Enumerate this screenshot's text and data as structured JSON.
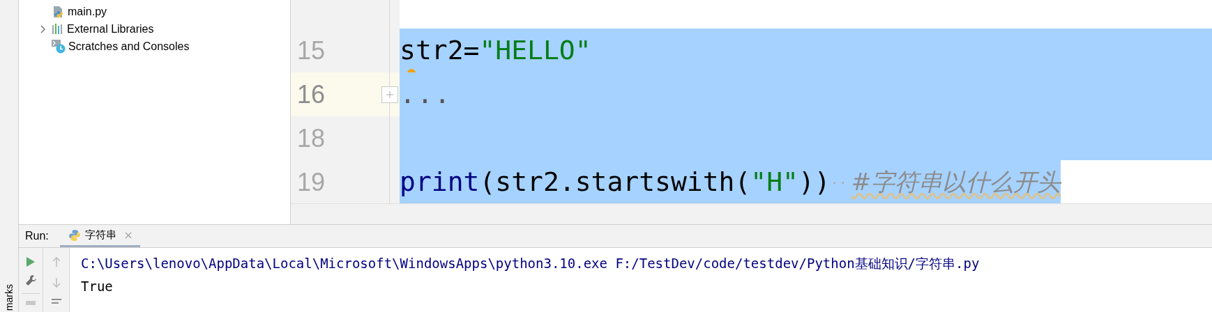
{
  "side_strip": {
    "label": "marks"
  },
  "project_tree": {
    "items": [
      {
        "label": "main.py",
        "kind": "python_file"
      },
      {
        "label": "External Libraries",
        "kind": "libraries",
        "expanded": false
      },
      {
        "label": "Scratches and Consoles",
        "kind": "scratches"
      }
    ]
  },
  "editor": {
    "lines": [
      {
        "number": "15",
        "selected": true,
        "current": false,
        "folded": false,
        "hint": true,
        "tokens": [
          {
            "kind": "plain",
            "text": "str2="
          },
          {
            "kind": "string",
            "text": "\"HELLO\""
          }
        ]
      },
      {
        "number": "16",
        "selected": true,
        "current": true,
        "folded": true,
        "hint": false,
        "tokens": [
          {
            "kind": "fold",
            "text": "..."
          }
        ]
      },
      {
        "number": "18",
        "selected": true,
        "current": false,
        "folded": false,
        "hint": false
      },
      {
        "number": "19",
        "selected": true,
        "current": false,
        "folded": false,
        "hint": false,
        "tokens": [
          {
            "kind": "builtin",
            "text": "print"
          },
          {
            "kind": "plain",
            "text": "(str2.startswith("
          },
          {
            "kind": "string",
            "text": "\"H\""
          },
          {
            "kind": "plain",
            "text": "))"
          },
          {
            "kind": "whitespace",
            "text": "··"
          },
          {
            "kind": "comment",
            "text": "#字符串以什么开头"
          }
        ]
      }
    ]
  },
  "run_panel": {
    "label": "Run:",
    "tabs": [
      {
        "label": "字符串",
        "selected": true
      }
    ],
    "console": [
      {
        "kind": "command",
        "text": "C:\\Users\\lenovo\\AppData\\Local\\Microsoft\\WindowsApps\\python3.10.exe F:/TestDev/code/testdev/Python基础知识/字符串.py"
      },
      {
        "kind": "output",
        "text": "True"
      }
    ]
  }
}
